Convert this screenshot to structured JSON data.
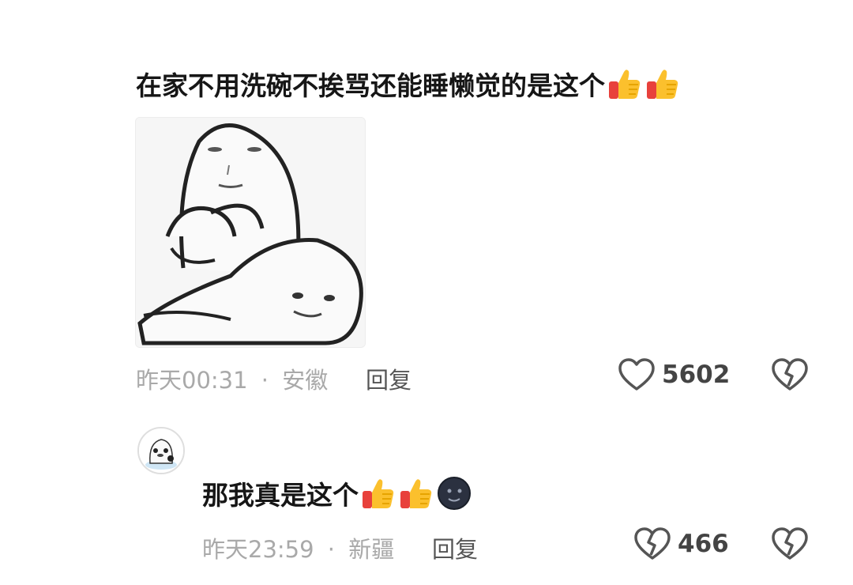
{
  "comment": {
    "text": "在家不用洗碗不挨骂还能睡懒觉的是这个",
    "emojis": [
      "thumbs-up",
      "thumbs-up"
    ],
    "time": "昨天00:31",
    "location": "安徽",
    "separator": "·",
    "reply_label": "回复",
    "like_count": "5602"
  },
  "reply": {
    "text": "那我真是这个",
    "emojis": [
      "thumbs-up",
      "thumbs-up",
      "new-moon-face"
    ],
    "time": "昨天23:59",
    "location": "新疆",
    "separator": "·",
    "reply_label": "回复",
    "like_count": "466"
  },
  "watermark": "",
  "colors": {
    "meta_gray": "#a9a9a9",
    "text_dark": "#161616",
    "icon_gray": "#555555"
  }
}
